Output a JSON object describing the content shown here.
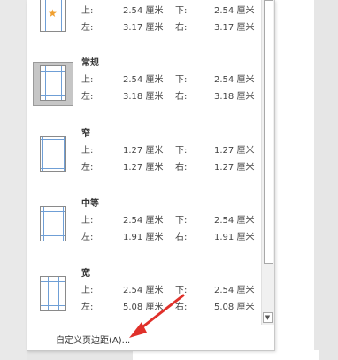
{
  "margins": {
    "items": [
      {
        "name": "",
        "top_label": "上:",
        "top": "2.54 厘米",
        "bottom_label": "下:",
        "bottom": "2.54 厘米",
        "left_label": "左:",
        "left": "3.17 厘米",
        "right_label": "右:",
        "right": "3.17 厘米",
        "icon": "star-icon"
      },
      {
        "name": "常规",
        "top_label": "上:",
        "top": "2.54 厘米",
        "bottom_label": "下:",
        "bottom": "2.54 厘米",
        "left_label": "左:",
        "left": "3.18 厘米",
        "right_label": "右:",
        "right": "3.18 厘米",
        "selected": true
      },
      {
        "name": "窄",
        "top_label": "上:",
        "top": "1.27 厘米",
        "bottom_label": "下:",
        "bottom": "1.27 厘米",
        "left_label": "左:",
        "left": "1.27 厘米",
        "right_label": "右:",
        "right": "1.27 厘米"
      },
      {
        "name": "中等",
        "top_label": "上:",
        "top": "2.54 厘米",
        "bottom_label": "下:",
        "bottom": "2.54 厘米",
        "left_label": "左:",
        "left": "1.91 厘米",
        "right_label": "右:",
        "right": "1.91 厘米"
      },
      {
        "name": "宽",
        "top_label": "上:",
        "top": "2.54 厘米",
        "bottom_label": "下:",
        "bottom": "2.54 厘米",
        "left_label": "左:",
        "left": "5.08 厘米",
        "right_label": "右:",
        "right": "5.08 厘米"
      }
    ],
    "custom_label": "自定义页边距(A)..."
  },
  "colors": {
    "guide_line": "#6f9fd6",
    "arrow": "#e0302a",
    "selected_bg": "#c6c6c6"
  },
  "icons": {
    "scroll_down": "chevron-down-icon",
    "annotation": "red-arrow-icon"
  }
}
